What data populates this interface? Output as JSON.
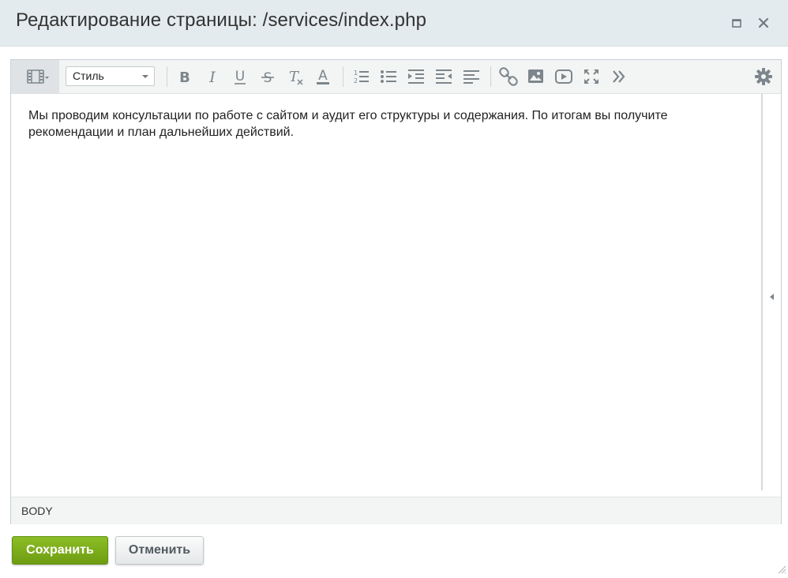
{
  "dialog": {
    "title": "Редактирование страницы: /services/index.php"
  },
  "toolbar": {
    "style_select": {
      "selected": "Стиль"
    },
    "buttons": [
      "bold-icon",
      "italic-icon",
      "underline-icon",
      "strikethrough-icon",
      "remove-format-icon",
      "font-color-icon",
      "numbered-list-icon",
      "bulleted-list-icon",
      "indent-icon",
      "outdent-icon",
      "align-left-icon",
      "link-icon",
      "image-icon",
      "video-icon",
      "fullscreen-icon",
      "more-icon",
      "settings-icon"
    ]
  },
  "content": {
    "text": "Мы проводим консультации по работе с сайтом и аудит его структуры и содержания. По итогам вы получите рекомендации и план дальнейших действий."
  },
  "statusbar": {
    "path": "BODY"
  },
  "actions": {
    "save_label": "Сохранить",
    "cancel_label": "Отменить"
  },
  "colors": {
    "save_button": "#7aab1b",
    "titlebar": "#e4ebee"
  }
}
